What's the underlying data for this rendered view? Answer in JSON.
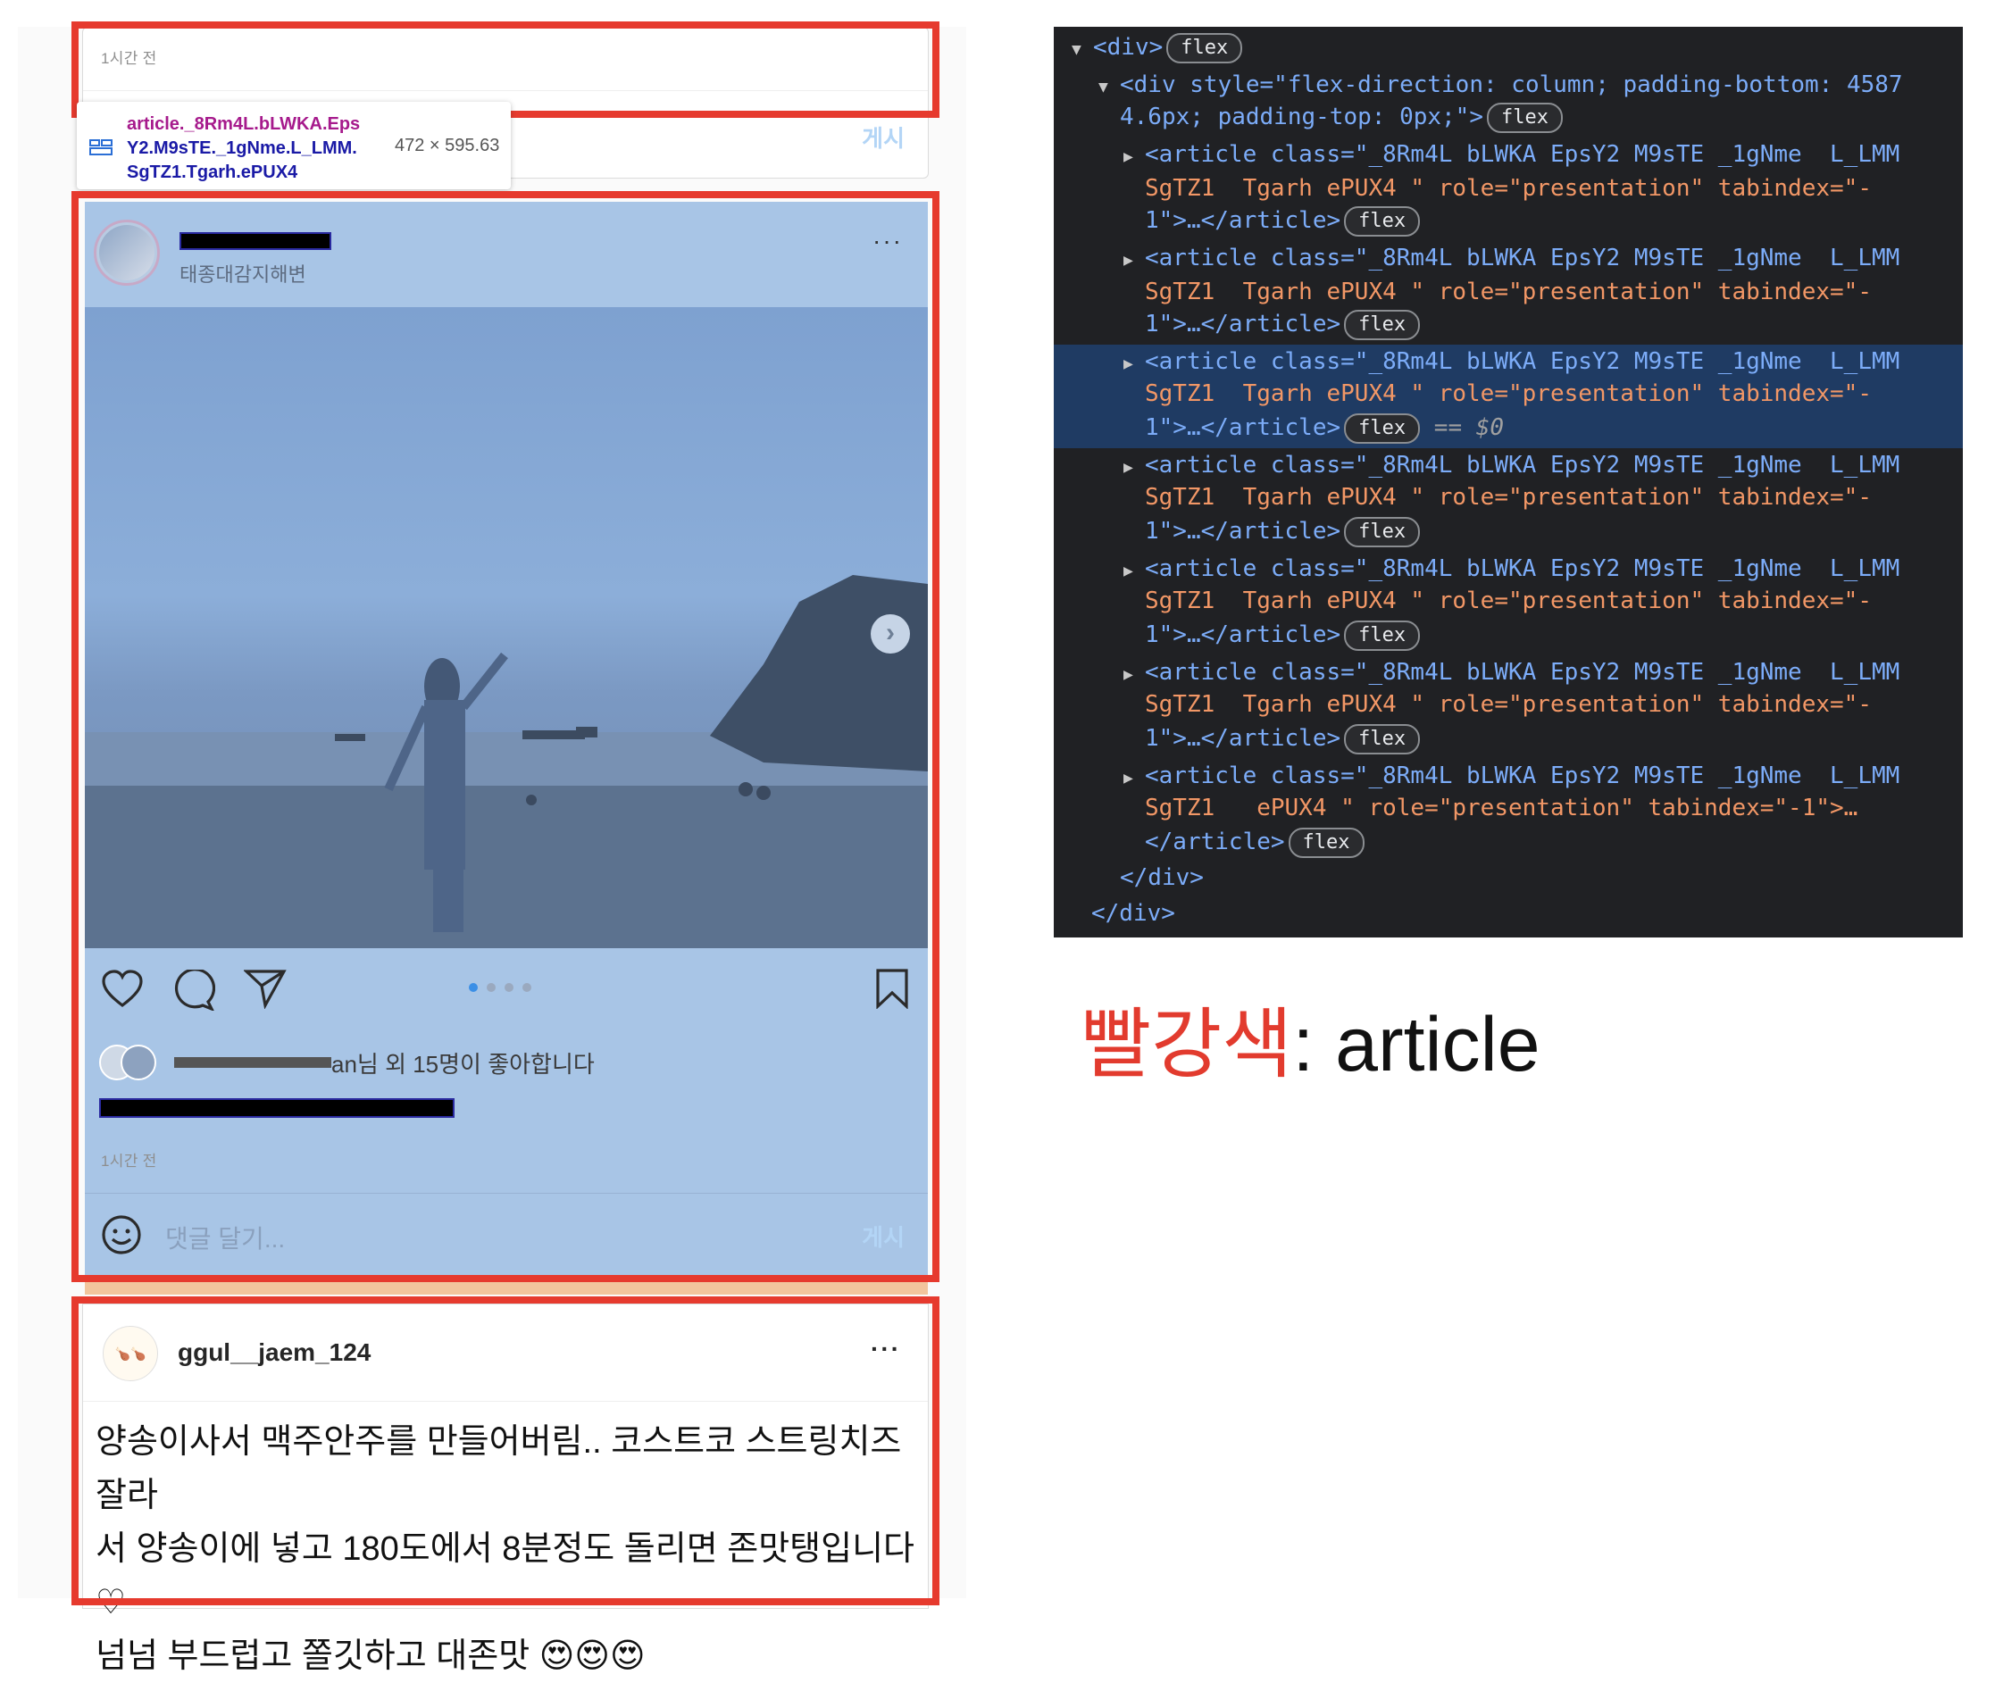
{
  "feed": {
    "post1": {
      "time": "1시간 전",
      "post_button": "게시"
    },
    "tooltip": {
      "selector_lines": [
        "article._8Rm4L.bLWKA.Eps",
        "Y2.M9sTE._1gNme.L_LMM.",
        "SgTZ1.Tgarh.ePUX4"
      ],
      "dimensions": "472 × 595.63"
    },
    "post2": {
      "location": "태종대감지해변",
      "more_icon": "···",
      "likes_text": "an님 외 15명이 좋아합니다",
      "time": "1시간 전",
      "comment_placeholder": "댓글 달기...",
      "post_button": "게시",
      "carousel_dots": 4
    },
    "post3": {
      "username": "ggul__jaem_124",
      "more_icon": "···",
      "caption_lines": [
        "양송이사서 맥주안주를 만들어버림.. 코스트코 스트링치즈 잘라",
        "서 양송이에 넣고 180도에서 8분정도 돌리면 존맛탱입니다♡",
        "넘넘 부드럽고 쫄깃하고 대존맛"
      ],
      "emoji": "😍😍😍"
    }
  },
  "devtools": {
    "badge_label": "flex",
    "root_div": "<div>",
    "inner_div_open": "<div style=\"flex-direction: column; padding-bottom: 4587",
    "inner_div_cont": "4.6px; padding-top: 0px;\">",
    "article_line1": "<article class=\"_8Rm4L bLWKA EpsY2 M9sTE _1gNme  L_LMM",
    "article_line2": "SgTZ1  Tgarh ePUX4 \" role=\"presentation\" tabindex=\"-",
    "article_line3": "1\">…</article>",
    "last_article_line2": "SgTZ1   ePUX4 \" role=\"presentation\" tabindex=\"-1\">…",
    "last_article_line3": "</article>",
    "selected_marker": "== $0",
    "close_inner": "</div>",
    "close_root": "</div>"
  },
  "legend": {
    "color_word": "빨강색",
    "rest": ": article"
  },
  "colors": {
    "highlight_border": "#e63a2e",
    "devtools_bg": "#202124",
    "selection_bg": "#1f3b63"
  }
}
